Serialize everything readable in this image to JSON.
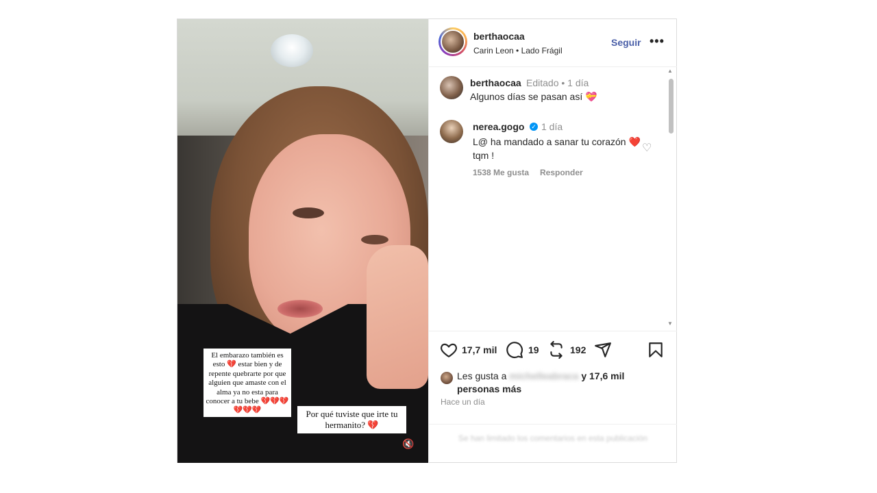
{
  "post": {
    "author": "berthaocaa",
    "music": "Carin Leon • Lado Frágil",
    "follow_label": "Seguir",
    "more_label": "•••"
  },
  "media": {
    "overlay_text_1": "El embarazo también es esto 💔 estar bien y de repente quebrarte por que alguien que amaste con el alma ya no esta para conocer a tu bebe 💔💔💔💔💔💔",
    "overlay_text_2": "Por qué tuviste que irte tu hermanito? 💔",
    "mute_icon": "🔇"
  },
  "comments": [
    {
      "username": "berthaocaa",
      "meta": "Editado • 1 día",
      "text": "Algunos días se pasan así 💝"
    },
    {
      "username": "nerea.gogo",
      "verified": true,
      "time": "1 día",
      "text": "L@ ha mandado a sanar tu corazón ❤️ tqm !",
      "likes": "1538 Me gusta",
      "reply_label": "Responder"
    }
  ],
  "actions": {
    "likes": "17,7 mil",
    "comments": "19",
    "reposts": "192"
  },
  "liked_by": {
    "prefix": "Les gusta a",
    "blurred_user": "michelleabraca",
    "suffix": "y 17,6 mil personas más"
  },
  "time_ago": "Hace un día",
  "comments_disabled": "Se han limitado los comentarios en esta publicación"
}
